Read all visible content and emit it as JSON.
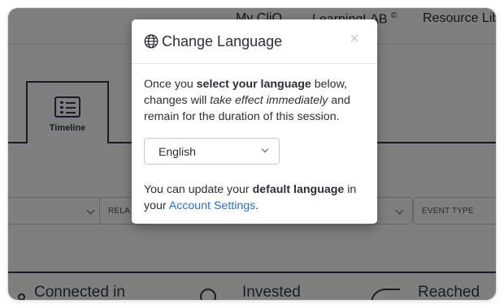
{
  "nav": {
    "my_cliq": "My CliQ",
    "learning_lab": "LearningLAB",
    "learning_lab_mark": "©",
    "resource_library": "Resource Lib"
  },
  "tabs": [
    {
      "label": "Timeline",
      "icon": "list-icon",
      "active": true
    }
  ],
  "filters": [
    {
      "label": ""
    },
    {
      "label": "RELA"
    },
    {
      "label": ""
    },
    {
      "label": "EVENT TYPE"
    }
  ],
  "stats": [
    {
      "label": "Connected in",
      "icon": "connection-icon"
    },
    {
      "label": "Invested",
      "icon": "circle-icon"
    },
    {
      "label": "Reached",
      "icon": "reach-icon"
    }
  ],
  "modal": {
    "icon": "globe-icon",
    "title": "Change Language",
    "close": "×",
    "body": {
      "t1": "Once you ",
      "b1": "select your language",
      "t2": " below, changes will ",
      "i1": "take effect immediately",
      "t3": " and remain for the duration of this session."
    },
    "select_value": "English",
    "footer": {
      "t1": "You can update your ",
      "b1": "default language",
      "t2": " in your ",
      "link": "Account Settings",
      "t3": "."
    }
  },
  "colors": {
    "overlay": "#000000",
    "link": "#1f6fd6",
    "text": "#2b2f36",
    "app_dark": "#2d3a4f"
  }
}
